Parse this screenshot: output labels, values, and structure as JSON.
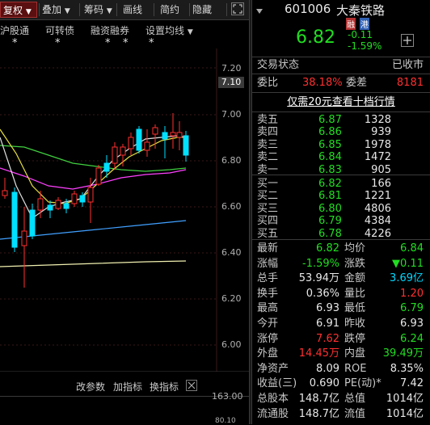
{
  "toolbar": {
    "items": [
      "复权",
      "叠加",
      "筹码",
      "画线",
      "简约",
      "隐藏"
    ],
    "selected_index": 0
  },
  "subbar": {
    "items": [
      "沪股通",
      "可转债",
      "融资融券",
      "设置均线"
    ],
    "stars": [
      "*",
      "*",
      "*",
      "*",
      "*"
    ]
  },
  "chart": {
    "price_labels": [
      "7.20",
      "7.00",
      "6.80",
      "6.60",
      "6.40",
      "6.20",
      "6.00"
    ],
    "current_price_tag": "7.10",
    "volume_labels": [
      "163.00",
      "80.10"
    ]
  },
  "bottom_bar": {
    "items": [
      "改参数",
      "加指标",
      "换指标"
    ]
  },
  "quote": {
    "code": "601006",
    "name": "大秦铁路",
    "badges": [
      "融",
      "港"
    ],
    "price": "6.82",
    "change": "-0.11",
    "change_pct": "-1.59%",
    "status_label": "交易状态",
    "status_value": "已收市",
    "weibi_label": "委比",
    "weibi_value": "38.18%",
    "weicha_label": "委差",
    "weicha_value": "8181",
    "promo": "仅需20元查看十档行情"
  },
  "order_book": {
    "asks": [
      {
        "label": "卖五",
        "price": "6.87",
        "volume": "1328"
      },
      {
        "label": "卖四",
        "price": "6.86",
        "volume": "939"
      },
      {
        "label": "卖三",
        "price": "6.85",
        "volume": "1978"
      },
      {
        "label": "卖二",
        "price": "6.84",
        "volume": "1472"
      },
      {
        "label": "卖一",
        "price": "6.83",
        "volume": "905"
      }
    ],
    "bids": [
      {
        "label": "买一",
        "price": "6.82",
        "volume": "166"
      },
      {
        "label": "买二",
        "price": "6.81",
        "volume": "1221"
      },
      {
        "label": "买三",
        "price": "6.80",
        "volume": "4806"
      },
      {
        "label": "买四",
        "price": "6.79",
        "volume": "4384"
      },
      {
        "label": "买五",
        "price": "6.78",
        "volume": "4226"
      }
    ]
  },
  "stats": [
    {
      "l1": "最新",
      "v1": "6.82",
      "c1": "green",
      "l2": "均价",
      "v2": "6.84",
      "c2": "green"
    },
    {
      "l1": "涨幅",
      "v1": "-1.59%",
      "c1": "green",
      "l2": "涨跌",
      "v2": "▼0.11",
      "c2": "green"
    },
    {
      "l1": "总手",
      "v1": "53.94万",
      "c1": "white",
      "l2": "金额",
      "v2": "3.69亿",
      "c2": "cyan"
    },
    {
      "l1": "换手",
      "v1": "0.36%",
      "c1": "white",
      "l2": "量比",
      "v2": "1.20",
      "c2": "red"
    },
    {
      "l1": "最高",
      "v1": "6.93",
      "c1": "white",
      "l2": "最低",
      "v2": "6.79",
      "c2": "green"
    },
    {
      "l1": "今开",
      "v1": "6.91",
      "c1": "white",
      "l2": "昨收",
      "v2": "6.93",
      "c2": "white"
    },
    {
      "l1": "涨停",
      "v1": "7.62",
      "c1": "red",
      "l2": "跌停",
      "v2": "6.24",
      "c2": "green"
    },
    {
      "l1": "外盘",
      "v1": "14.45万",
      "c1": "red",
      "l2": "内盘",
      "v2": "39.49万",
      "c2": "green"
    },
    {
      "l1": "净资产",
      "v1": "8.09",
      "c1": "white",
      "l2": "ROE",
      "v2": "8.35%",
      "c2": "white"
    },
    {
      "l1": "收益(三)",
      "v1": "0.690",
      "c1": "white",
      "l2": "PE(动)*",
      "v2": "7.42",
      "c2": "white"
    },
    {
      "l1": "总股本",
      "v1": "148.7亿",
      "c1": "white",
      "l2": "总值",
      "v2": "1014亿",
      "c2": "white"
    },
    {
      "l1": "流通股",
      "v1": "148.7亿",
      "c1": "white",
      "l2": "流值",
      "v2": "1014亿",
      "c2": "white"
    }
  ],
  "colors": {
    "up": "#ff3030",
    "down": "#22dd22",
    "ma5": "#e0e0e0",
    "ma10": "#e8e040",
    "ma20": "#ff40ff",
    "ma30": "#40d040",
    "ma60": "#40a0ff"
  },
  "icons": {
    "dropdown": "triangle-down-icon",
    "maximize": "maximize-icon",
    "plus": "plus-icon"
  }
}
